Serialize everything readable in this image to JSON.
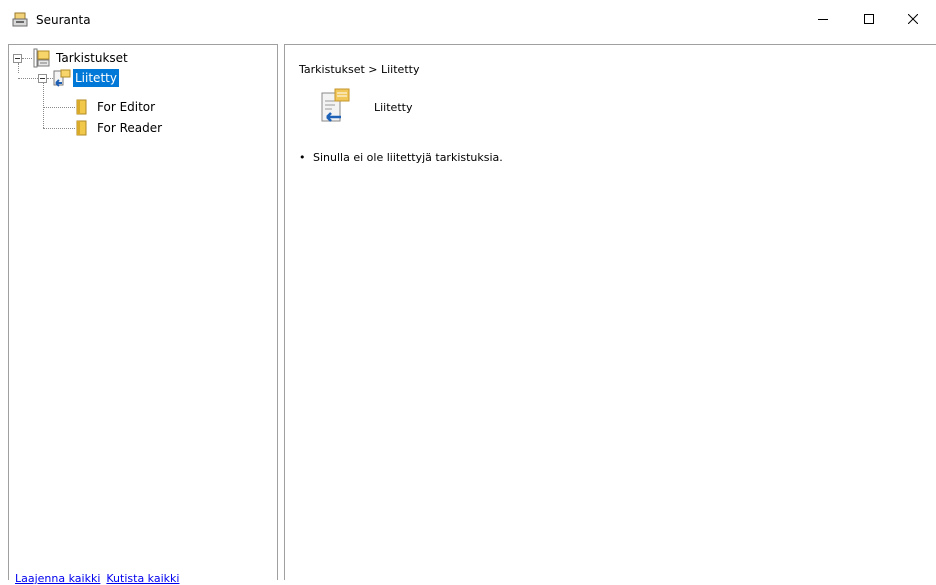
{
  "window": {
    "title": "Seuranta",
    "app_icon": "seuranta-app-icon",
    "controls": {
      "minimize": "minimize-icon",
      "maximize": "maximize-icon",
      "close": "close-icon"
    }
  },
  "tree": {
    "root": {
      "label": "Tarkistukset",
      "icon": "tarkistukset-icon",
      "expanded": true
    },
    "items": [
      {
        "label": "Liitetty",
        "icon": "liitetty-icon",
        "selected": true,
        "expanded": true
      },
      {
        "label": "For Editor",
        "icon": "folder-icon"
      },
      {
        "label": "For Reader",
        "icon": "folder-icon"
      }
    ]
  },
  "links": {
    "expand_all": "Laajenna kaikki",
    "collapse_all": "Kutista kaikki"
  },
  "detail": {
    "breadcrumb": "Tarkistukset > Liitetty",
    "section_title": "Liitetty",
    "message": "Sinulla ei ole liitettyjä tarkistuksia."
  },
  "colors": {
    "selection": "#0078d7",
    "link": "#0000ee",
    "border": "#a0a0a0"
  }
}
